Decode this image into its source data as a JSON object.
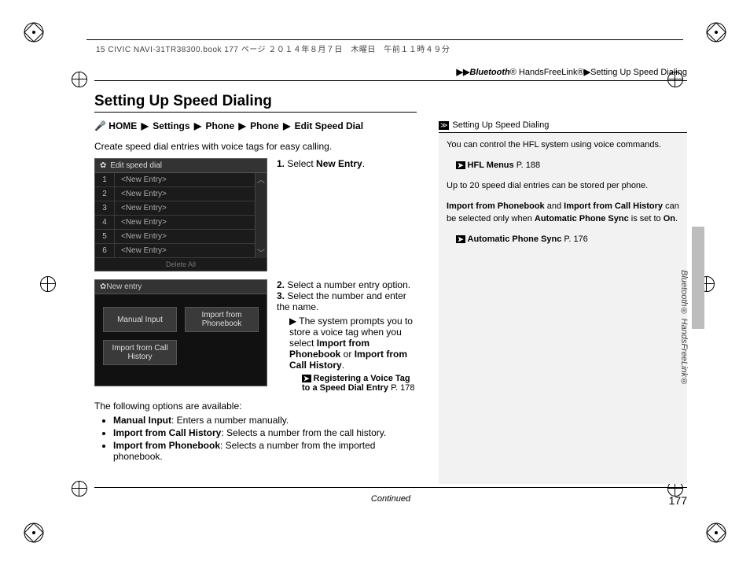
{
  "print_header": "15 CIVIC NAVI-31TR38300.book  177 ページ  ２０１４年８月７日　木曜日　午前１１時４９分",
  "breadcrumb": {
    "prefix": "▶▶",
    "seg1_italic": "Bluetooth",
    "seg1_rest": "® HandsFreeLink®",
    "seg2": "Setting Up Speed Dialing"
  },
  "title": "Setting Up Speed Dialing",
  "nav_path": {
    "icon_hint": "voice-icon",
    "items": [
      "HOME",
      "Settings",
      "Phone",
      "Phone",
      "Edit Speed Dial"
    ]
  },
  "intro": "Create speed dial entries with voice tags for easy calling.",
  "ui_screenshot1": {
    "header": "Edit speed dial",
    "rows": [
      {
        "n": "1",
        "v": "<New Entry>"
      },
      {
        "n": "2",
        "v": "<New Entry>"
      },
      {
        "n": "3",
        "v": "<New Entry>"
      },
      {
        "n": "4",
        "v": "<New Entry>"
      },
      {
        "n": "5",
        "v": "<New Entry>"
      },
      {
        "n": "6",
        "v": "<New Entry>"
      }
    ],
    "footer": "Delete All"
  },
  "step1": {
    "num": "1.",
    "pre": "Select ",
    "bold": "New Entry",
    "post": "."
  },
  "ui_screenshot2": {
    "header": "New entry",
    "buttons": [
      "Manual Input",
      "Import from Phonebook",
      "Import from Call History"
    ]
  },
  "step2": {
    "num": "2.",
    "text": "Select a number entry option."
  },
  "step3": {
    "num": "3.",
    "text": "Select the number and enter the name."
  },
  "step3_sub": {
    "pre": "The system prompts you to store a voice tag when you select ",
    "b1": "Import from Phonebook",
    "mid": " or ",
    "b2": "Import from Call History",
    "post": "."
  },
  "step3_ref": {
    "label": "Registering a Voice Tag to a Speed Dial Entry",
    "page": "P. 178"
  },
  "options_heading": "The following options are available:",
  "options": [
    {
      "b": "Manual Input",
      "rest": ": Enters a number manually."
    },
    {
      "b": "Import from Call History",
      "rest": ": Selects a number from the call history."
    },
    {
      "b": "Import from Phonebook",
      "rest": ": Selects a number from the imported phonebook."
    }
  ],
  "sidebar": {
    "head": "Setting Up Speed Dialing",
    "p1": "You can control the HFL system using voice commands.",
    "ref1": {
      "label": "HFL Menus",
      "page": "P. 188"
    },
    "p2": "Up to 20 speed dial entries can be stored per phone.",
    "p3_parts": {
      "b1": "Import from Phonebook",
      "t1": " and ",
      "b2": "Import from Call History",
      "t2": " can be selected only when ",
      "b3": "Automatic Phone Sync",
      "t3": " is set to ",
      "b4": "On",
      "t4": "."
    },
    "ref2": {
      "label": "Automatic Phone Sync",
      "page": "P. 176"
    }
  },
  "side_label": "Bluetooth® HandsFreeLink®",
  "continued": "Continued",
  "page_number": "177"
}
